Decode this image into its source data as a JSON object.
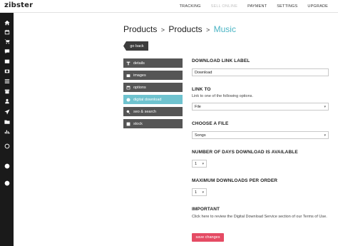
{
  "app": {
    "logo": "zibster",
    "nav": [
      "TRACKING",
      "SELL ONLINE",
      "PAYMENT",
      "SETTINGS",
      "UPGRADE"
    ],
    "nav_active": "SELL ONLINE",
    "accent": "#4ab4c4",
    "sidebar_bg": "#1a1a1a"
  },
  "sidebar": {
    "icons": [
      "home-icon",
      "calendar-icon",
      "cart-icon",
      "chat-icon",
      "photo-icon",
      "dollar-icon",
      "list-icon",
      "box-icon",
      "user-icon",
      "send-icon",
      "folder-icon",
      "chart-icon",
      "globe-icon",
      "person-icon",
      "add-icon"
    ]
  },
  "breadcrumb": {
    "first": "Products",
    "sep1": ">",
    "second": "Products",
    "sep2": ">",
    "current": "Music"
  },
  "back_button": "go back",
  "menu": {
    "items": [
      {
        "label": "details",
        "icon": "text-icon"
      },
      {
        "label": "images",
        "icon": "image-icon"
      },
      {
        "label": "options",
        "icon": "options-icon"
      },
      {
        "label": "digital download",
        "icon": "download-icon"
      },
      {
        "label": "seo & search",
        "icon": "search-icon"
      },
      {
        "label": "stock",
        "icon": "stock-icon"
      }
    ],
    "active": "digital download"
  },
  "form": {
    "link_label": {
      "label": "DOWNLOAD LINK LABEL",
      "value": "Download"
    },
    "link_to": {
      "label": "LINK TO",
      "hint": "Link to one of the following options.",
      "value": "File"
    },
    "choose_file": {
      "label": "CHOOSE A FILE",
      "value": "Songs"
    },
    "days_available": {
      "label": "NUMBER OF DAYS DOWNLOAD IS AVAILABLE",
      "value": "1"
    },
    "max_downloads": {
      "label": "MAXIMUM DOWNLOADS PER ORDER",
      "value": "1"
    },
    "important": {
      "label": "IMPORTANT",
      "text": "Click here to review the Digital Download Service section of our Terms of Use."
    }
  },
  "save_button": "save changes",
  "save_color": "#e54b64"
}
